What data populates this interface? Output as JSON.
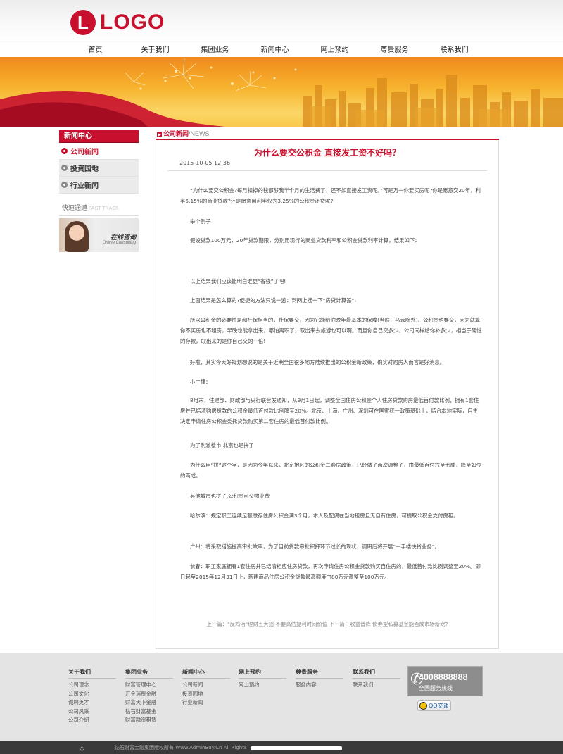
{
  "header": {
    "logo_letter": "L",
    "logo_text": "LOGO"
  },
  "nav": [
    "首页",
    "关于我们",
    "集团业务",
    "新闻中心",
    "网上预约",
    "尊贵服务",
    "联系我们"
  ],
  "sidebar": {
    "title": "新闻中心",
    "items": [
      "公司新闻",
      "投资园地",
      "行业新闻"
    ],
    "fast_label": "快速通道",
    "fast_en": "FAST TRACK",
    "consult_label": "在线咨询",
    "consult_sub": "Online Consulting"
  },
  "content": {
    "category": "公司新闻",
    "category_en": "/NEWS",
    "title": "为什么要交公积金 直接发工资不好吗？",
    "date": "2015-10-05 12:36",
    "paragraphs": [
      "“为什么要交公积金?每月扣掉的钱都够我半个月的生活费了，还不如直接发工资呢。”可是万一你要买房呢?你是愿意交20年，利率5.15%的商业贷款?还是愿意用利率仅为3.25%的公积金还贷呢?",
      "举个例子",
      "假设贷款100万元，20年贷款期限，分别用现行的商业贷款利率和公积金贷款利率计算，结果如下：",
      "以上结果我们应该能明白谁更“省钱”了吧!",
      "上面结果是怎么算的?便捷的方法只说一遍：到网上搜一下“房贷计算器”!",
      "所以公积金的必要性是和社保相当的，社保要交，因为它能给你晚年最基本的保障(当然，马云除外)。公积金也要交，因为就算你不买房也不租房，早晚也能拿出来，哪怕离职了，取出来去旅游也可以啊。而且你自己交多少，公司同样给你补多少，相当于硬性的存款，取出来的是你自己交的一倍!",
      "好啦，其实今天好规划想说的是关于近期全国很多地方陆续推出的公积金新政策，确实对购房人而言是好消息。",
      "小广播：",
      "8月末，住建部、财政部与央行联合发通知，从9月1日起，调整全国住房公积金个人住房贷款购房最低首付款比例，拥有1套住房并已结清购房贷款的公积金最低首付款比例降至20%。北京、上海、广州、深圳可在国家统一政策基础上，结合本地实际，自主决定申请住房公积金委托贷款购买第二套住房的最低首付款比例。",
      "为了刺激楼市,北京也是拼了",
      "为什么用“拼”这个字，是因为今年以来，北京地区的公积金二套房政策，已经做了两次调整了，由最低首付六至七成，降至如今的两成。",
      "其他城市也拼了,公积金可交物业费",
      "哈尔滨：规定职工连续足额缴存住房公积金满3个月，本人及配偶在当地租房且无自有住房，可提取公积金支付房租。",
      "广州：将采取措施提高审批效率，为了目前贷款审批积押环节过长的现状，调研后将开展“一手楼快贷业务”。",
      "长春：职工家庭拥有1套住房并已结清相应住房贷款，再次申请住房公积金贷款购买自住房的，最低首付款比例调整至20%。即日起至2015年12月31日止，新建商品住房公积金贷款最高额度由80万元调整至100万元。"
    ],
    "pager": "上一篇：\"反鸡汤\"理财五大招 不要高估复利时间价值   下一篇：收益普降 债券型私募基金能否成市场新宠?"
  },
  "footer": {
    "columns": [
      {
        "title": "关于我们",
        "links": [
          "公司理念",
          "公司文化",
          "诚聘英才",
          "公司风采",
          "公司介绍"
        ]
      },
      {
        "title": "集团业务",
        "links": [
          "财富管理中心",
          "汇金消费金融",
          "财富天下金融",
          "钻石财富基金",
          "财富融资租赁"
        ]
      },
      {
        "title": "新闻中心",
        "links": [
          "公司新闻",
          "投资园地",
          "行业新闻"
        ]
      },
      {
        "title": "网上预约",
        "links": [
          "网上预约"
        ]
      },
      {
        "title": "尊贵服务",
        "links": [
          "服务内容"
        ]
      },
      {
        "title": "联系我们",
        "links": [
          "联系我们"
        ]
      }
    ],
    "hotline_number": "4008888888",
    "hotline_label": "全国服务热线",
    "qq_label": "QQ交谈",
    "copyright": "钻石财富金融集团版权所有 Www.AdminBuy.Cn All Rights"
  },
  "colors": {
    "accent": "#c8102e",
    "footer_bg": "#e4e4e4"
  }
}
